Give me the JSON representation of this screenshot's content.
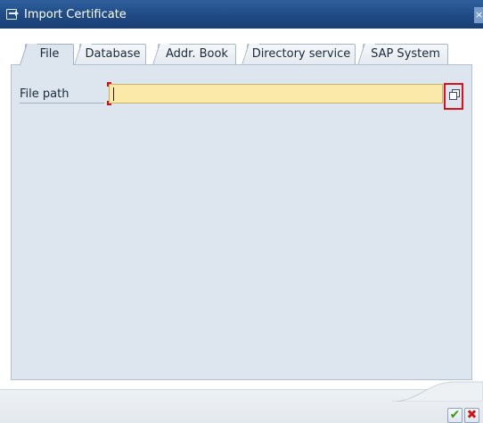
{
  "window": {
    "title": "Import Certificate",
    "icon": "import-icon",
    "close_label": "×"
  },
  "tabs": [
    {
      "label": "File",
      "active": true
    },
    {
      "label": "Database",
      "active": false
    },
    {
      "label": "Addr. Book",
      "active": false
    },
    {
      "label": "Directory service",
      "active": false
    },
    {
      "label": "SAP System",
      "active": false
    }
  ],
  "form": {
    "file_path_label": "File path",
    "file_path_value": "",
    "browse_icon": "browse-file-icon"
  },
  "footer": {
    "ok_glyph": "✔",
    "cancel_glyph": "✖"
  },
  "colors": {
    "titlebar": "#1f4a84",
    "panel": "#dde6ef",
    "input_required": "#fae9a8",
    "highlight": "#e0101a",
    "ok": "#3d9a1a",
    "cancel": "#d0161a"
  }
}
